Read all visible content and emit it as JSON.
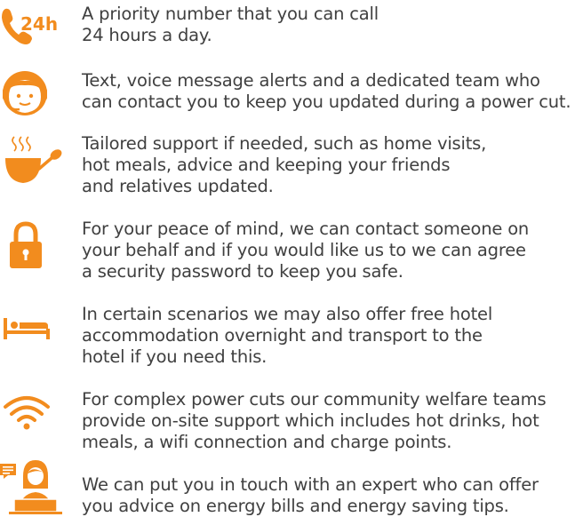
{
  "accent_color": "#F28C1E",
  "items": [
    {
      "icon": "phone-24h-icon",
      "badge": "24h",
      "lines": [
        "A priority number that you can call",
        "24 hours a day."
      ]
    },
    {
      "icon": "headset-agent-icon",
      "lines": [
        "Text, voice message alerts and a dedicated team who",
        "can contact you to keep you updated during a power cut."
      ]
    },
    {
      "icon": "hot-meal-bowl-icon",
      "lines": [
        "Tailored support if needed, such as home visits,",
        "hot meals, advice and keeping your friends",
        "and relatives updated."
      ]
    },
    {
      "icon": "padlock-icon",
      "lines": [
        "For your peace of mind, we can contact someone on",
        "your behalf and if you would like us to we can agree",
        "a security password to keep you safe."
      ]
    },
    {
      "icon": "hotel-bed-icon",
      "lines": [
        "In certain scenarios we may also offer free hotel",
        "accommodation overnight and transport to the",
        "hotel if you need this."
      ]
    },
    {
      "icon": "wifi-icon",
      "lines": [
        "For complex power cuts our community welfare teams",
        "provide on-site support which includes hot drinks, hot",
        "meals, a wifi connection and charge points."
      ]
    },
    {
      "icon": "advisor-laptop-icon",
      "lines": [
        "We can put you in touch with an expert who can offer",
        "you advice on energy bills and energy saving tips."
      ]
    }
  ]
}
